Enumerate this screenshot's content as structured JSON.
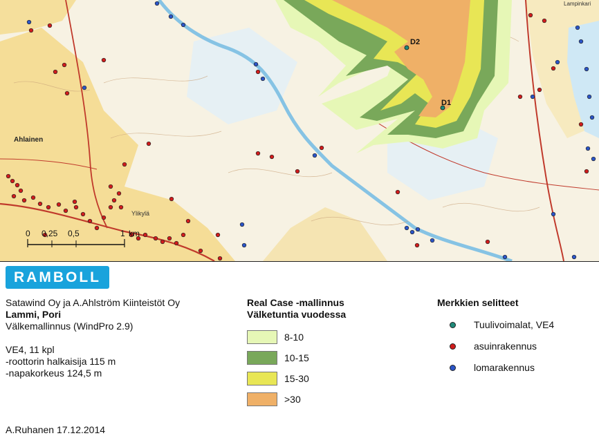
{
  "map": {
    "place_labels": {
      "ahlainen": "Ahlainen",
      "ylikyla": "Ylikylä",
      "lampinkari": "Lampinkari",
      "d1": "D1",
      "d2": "D2"
    },
    "scale_bar": {
      "ticks": [
        "0",
        "0,25",
        "0,5",
        "1"
      ],
      "unit": "km"
    }
  },
  "logo": {
    "text": "RAMBOLL"
  },
  "info": {
    "client": "Satawind Oy ja A.Ahlström Kiinteistöt Oy",
    "project": "Lammi, Pori",
    "subtitle": "Välkemallinnus (WindPro 2.9)",
    "scenario": "VE4, 11 kpl",
    "rotor": "-roottorin halkaisija 115 m",
    "hub": "-napakorkeus 124,5 m"
  },
  "footer": {
    "author_date": "A.Ruhanen 17.12.2014"
  },
  "legend": {
    "title_line1": "Real Case -mallinnus",
    "title_line2": "Välketuntia vuodessa",
    "classes": [
      {
        "label": "8-10",
        "color": "#e6f7b6"
      },
      {
        "label": "10-15",
        "color": "#79a85a"
      },
      {
        "label": "15-30",
        "color": "#e8e655"
      },
      {
        "label": ">30",
        "color": "#efb067"
      }
    ]
  },
  "symbols": {
    "title": "Merkkien selitteet",
    "items": [
      {
        "label": "Tuulivoimalat, VE4",
        "color": "#1f8a7a"
      },
      {
        "label": "asuinrakennus",
        "color": "#d01c1c"
      },
      {
        "label": "lomarakennus",
        "color": "#2b55c8"
      }
    ]
  },
  "colors": {
    "terrain": "#f7f2e3",
    "field": "#f4d98a",
    "water": "#cfe8f5",
    "river": "#86c3e4",
    "road": "#c0392b"
  }
}
